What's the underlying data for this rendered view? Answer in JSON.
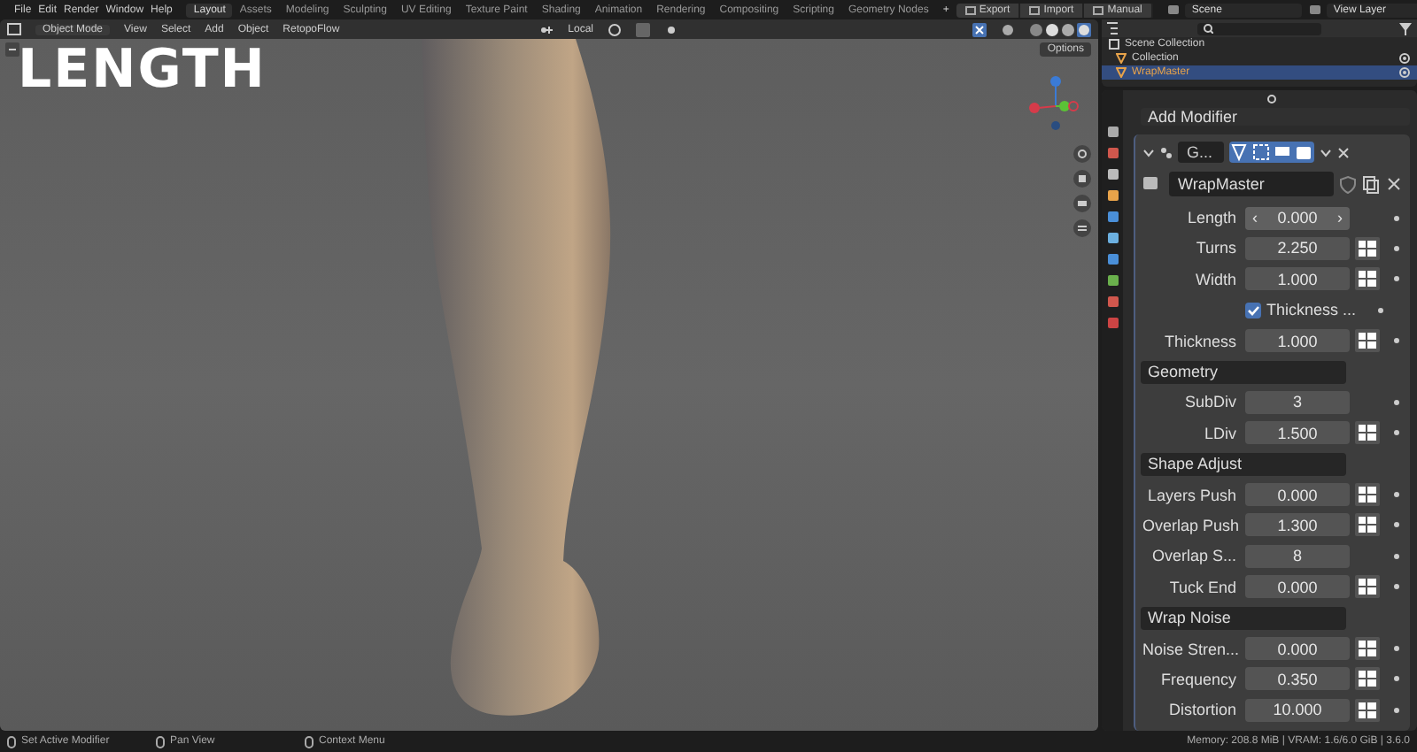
{
  "menu": [
    "File",
    "Edit",
    "Render",
    "Window",
    "Help"
  ],
  "workspace_tabs": [
    {
      "label": "Layout",
      "selected": true
    },
    {
      "label": "Assets",
      "selected": false
    },
    {
      "label": "Modeling",
      "selected": false
    },
    {
      "label": "Sculpting",
      "selected": false
    },
    {
      "label": "UV Editing",
      "selected": false
    },
    {
      "label": "Texture Paint",
      "selected": false
    },
    {
      "label": "Shading",
      "selected": false
    },
    {
      "label": "Animation",
      "selected": false
    },
    {
      "label": "Rendering",
      "selected": false
    },
    {
      "label": "Compositing",
      "selected": false
    },
    {
      "label": "Scripting",
      "selected": false
    },
    {
      "label": "Geometry Nodes",
      "selected": false
    }
  ],
  "add_tab": "+",
  "header_buttons": [
    "Export",
    "Import",
    "Manual"
  ],
  "scene": "Scene",
  "view_layer": "View Layer",
  "viewport": {
    "mode": "Object Mode",
    "menus": [
      "View",
      "Select",
      "Add",
      "Object",
      "RetopoFlow"
    ],
    "orientation": "Local",
    "options": "Options",
    "caption": "LENGTH"
  },
  "outliner": {
    "root": "Scene Collection",
    "items": [
      {
        "label": "Collection",
        "selected": false
      },
      {
        "label": "WrapMaster",
        "selected": true
      }
    ]
  },
  "properties": {
    "add_modifier": "Add Modifier",
    "modifier_name": "G...",
    "object_name": "WrapMaster",
    "rows": [
      {
        "kind": "stepper",
        "label": "Length",
        "value": "0.000",
        "decrement": "‹",
        "increment": "›",
        "linked": false
      },
      {
        "kind": "field",
        "label": "Turns",
        "value": "2.250",
        "linked": true
      },
      {
        "kind": "field",
        "label": "Width",
        "value": "1.000",
        "linked": true
      },
      {
        "kind": "checkbox",
        "label": "Thickness ...",
        "checked": true
      },
      {
        "kind": "field",
        "label": "Thickness",
        "value": "1.000",
        "linked": true
      },
      {
        "kind": "section",
        "label": "Geometry"
      },
      {
        "kind": "field",
        "label": "SubDiv",
        "value": "3",
        "linked": false
      },
      {
        "kind": "field",
        "label": "LDiv",
        "value": "1.500",
        "linked": true
      },
      {
        "kind": "section",
        "label": "Shape Adjust"
      },
      {
        "kind": "field",
        "label": "Layers Push",
        "value": "0.000",
        "linked": true
      },
      {
        "kind": "field",
        "label": "Overlap Push",
        "value": "1.300",
        "linked": true
      },
      {
        "kind": "field",
        "label": "Overlap S...",
        "value": "8",
        "linked": false
      },
      {
        "kind": "field",
        "label": "Tuck End",
        "value": "0.000",
        "linked": true
      },
      {
        "kind": "section",
        "label": "Wrap Noise"
      },
      {
        "kind": "field",
        "label": "Noise Stren...",
        "value": "0.000",
        "linked": true
      },
      {
        "kind": "field",
        "label": "Frequency",
        "value": "0.350",
        "linked": true
      },
      {
        "kind": "field",
        "label": "Distortion",
        "value": "10.000",
        "linked": true
      }
    ]
  },
  "status_bar": {
    "hints": [
      "Set Active Modifier",
      "Pan View",
      "Context Menu"
    ],
    "info": "Memory: 208.8 MiB | VRAM: 1.6/6.0 GiB | 3.6.0"
  }
}
